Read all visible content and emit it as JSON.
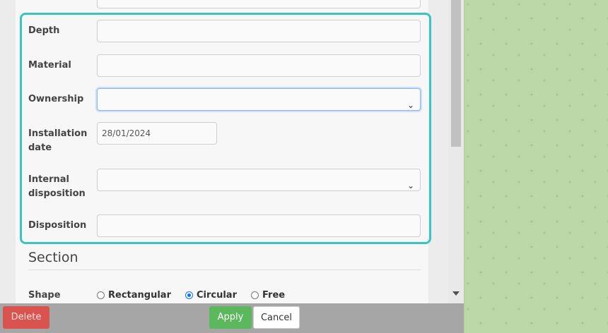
{
  "form": {
    "fields": [
      {
        "label": "Depth",
        "value": ""
      },
      {
        "label": "Material",
        "value": ""
      },
      {
        "label": "Ownership",
        "value": ""
      },
      {
        "label": "Installation date",
        "value": "28/01/2024"
      },
      {
        "label": "Internal disposition",
        "value": ""
      },
      {
        "label": "Disposition",
        "value": ""
      }
    ],
    "installation_date_line1": "Installation",
    "installation_date_line2": "date",
    "internal_disposition_line1": "Internal",
    "internal_disposition_line2": "disposition"
  },
  "section": {
    "title": "Section",
    "shape_label": "Shape",
    "shape_options": [
      "Rectangular",
      "Circular",
      "Free"
    ],
    "shape_selected": "Circular"
  },
  "footer": {
    "delete_label": "Delete",
    "apply_label": "Apply",
    "cancel_label": "Cancel"
  },
  "colors": {
    "highlight": "#3cc3c6",
    "delete": "#d9534f",
    "apply": "#5cb85c",
    "map": "#bcd8a8"
  }
}
